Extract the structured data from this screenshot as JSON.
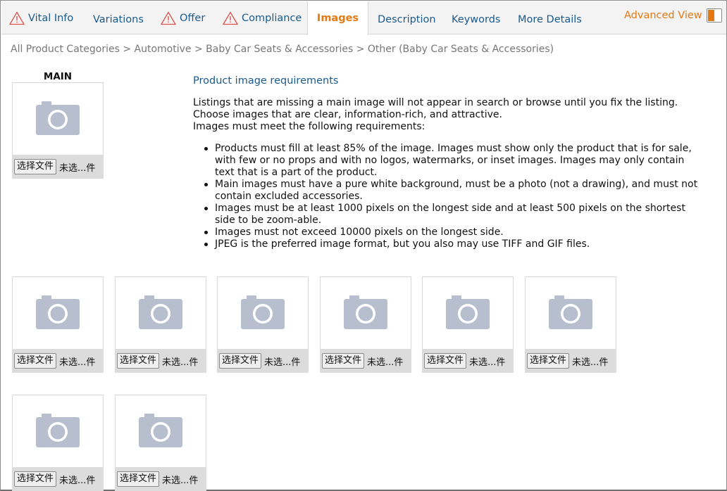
{
  "tabs": [
    {
      "label": "Vital Info",
      "warning": true,
      "active": false
    },
    {
      "label": "Variations",
      "warning": false,
      "active": false
    },
    {
      "label": "Offer",
      "warning": true,
      "active": false
    },
    {
      "label": "Compliance",
      "warning": true,
      "active": false
    },
    {
      "label": "Images",
      "warning": false,
      "active": true
    },
    {
      "label": "Description",
      "warning": false,
      "active": false
    },
    {
      "label": "Keywords",
      "warning": false,
      "active": false
    },
    {
      "label": "More Details",
      "warning": false,
      "active": false
    }
  ],
  "advanced_view": {
    "label": "Advanced View",
    "toggle_on": true
  },
  "breadcrumb": {
    "items": [
      "All Product Categories",
      "Automotive",
      "Baby Car Seats & Accessories",
      "Other (Baby Car Seats & Accessories)"
    ],
    "separator": ">"
  },
  "main_image": {
    "label": "MAIN",
    "button_label": "选择文件",
    "status": "未选...件"
  },
  "requirements": {
    "title": "Product image requirements",
    "intro": [
      "Listings that are missing a main image will not appear in search or browse until you fix the listing.",
      "Choose images that are clear, information-rich, and attractive.",
      "Images must meet the following requirements:"
    ],
    "bullets": [
      "Products must fill at least 85% of the image. Images must show only the product that is for sale, with few or no props and with no logos, watermarks, or inset images. Images may only contain text that is a part of the product.",
      "Main images must have a pure white background, must be a photo (not a drawing), and must not contain excluded accessories.",
      "Images must be at least 1000 pixels on the longest side and at least 500 pixels on the shortest side to be zoom-able.",
      "Images must not exceed 10000 pixels on the longest side.",
      "JPEG is the preferred image format, but you also may use TIFF and GIF files."
    ]
  },
  "additional_images": [
    {
      "button_label": "选择文件",
      "status": "未选...件"
    },
    {
      "button_label": "选择文件",
      "status": "未选...件"
    },
    {
      "button_label": "选择文件",
      "status": "未选...件"
    },
    {
      "button_label": "选择文件",
      "status": "未选...件"
    },
    {
      "button_label": "选择文件",
      "status": "未选...件"
    },
    {
      "button_label": "选择文件",
      "status": "未选...件"
    },
    {
      "button_label": "选择文件",
      "status": "未选...件"
    },
    {
      "button_label": "选择文件",
      "status": "未选...件"
    }
  ],
  "colors": {
    "link": "#1a5a8c",
    "accent": "#e47911",
    "warning": "#d9534f",
    "camera": "#b7bfcf"
  },
  "icons": {
    "warning": "warning-triangle-icon",
    "camera": "camera-placeholder-icon"
  }
}
